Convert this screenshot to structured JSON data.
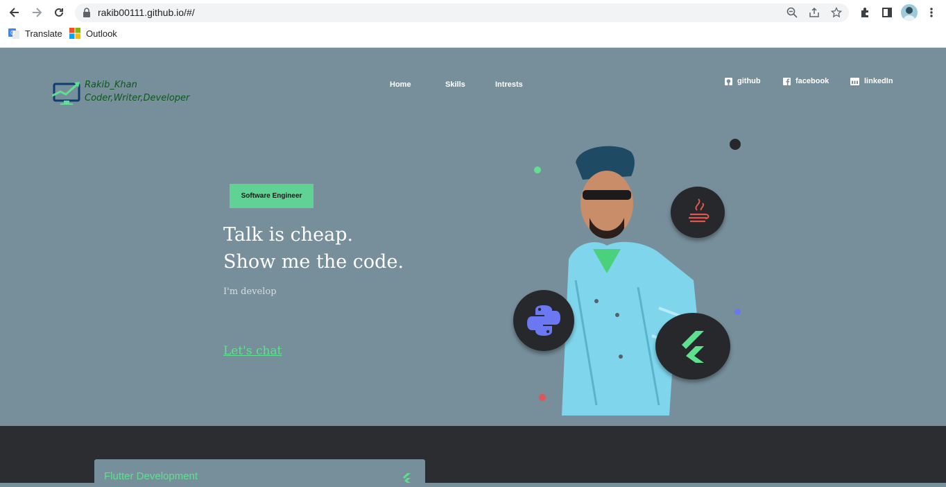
{
  "browser": {
    "url": "rakib00111.github.io/#/",
    "bookmarks": [
      {
        "label": "Translate",
        "icon": "google-translate-icon"
      },
      {
        "label": "Outlook",
        "icon": "outlook-icon"
      }
    ]
  },
  "site": {
    "logo": {
      "line1": "Rakib_Khan",
      "line2": "Coder,Writer,Developer"
    },
    "nav": [
      "Home",
      "Skills",
      "Intrests"
    ],
    "social": [
      {
        "label": "github",
        "icon": "github-icon"
      },
      {
        "label": "facebook",
        "icon": "facebook-icon"
      },
      {
        "label": "linkedIn",
        "icon": "linkedin-icon"
      }
    ],
    "hero": {
      "badge": "Software Engineer",
      "headline_line1": "Talk is cheap.",
      "headline_line2": "Show me the code.",
      "subtext": "I'm develop",
      "cta": "Let's chat"
    },
    "tech_icons": [
      "java-icon",
      "python-icon",
      "flutter-icon"
    ],
    "services": [
      {
        "title": "Flutter Development",
        "icon": "flutter-icon"
      }
    ]
  },
  "colors": {
    "accent": "#60d394",
    "hero_bg": "#778f9b",
    "dark_bg": "#2c2d30"
  }
}
